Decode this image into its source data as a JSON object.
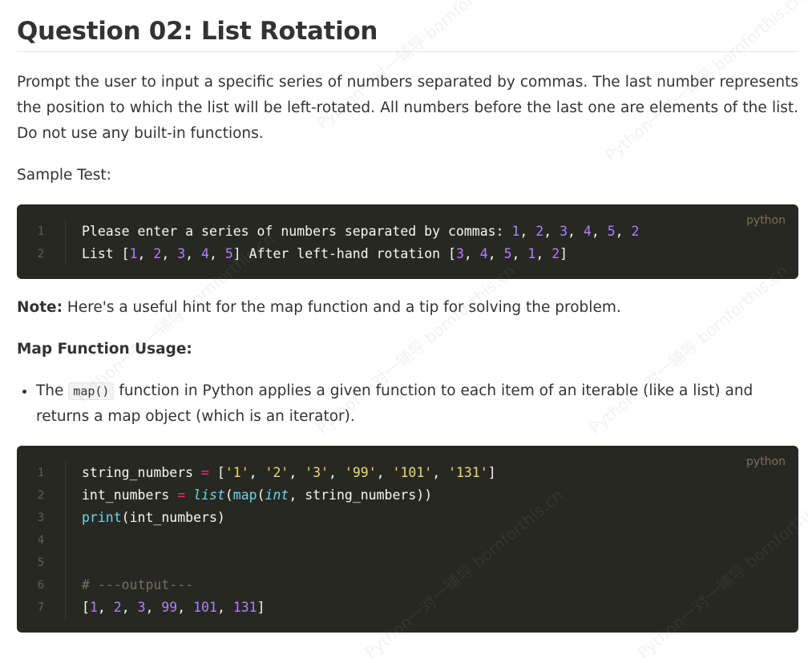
{
  "title": "Question 02: List Rotation",
  "prompt": "Prompt the user to input a specific series of numbers separated by commas. The last number represents the position to which the list will be left-rotated. All numbers before the last one are elements of the list. Do not use any built-in functions.",
  "sample_label": "Sample Test:",
  "sample_code": {
    "lang": "python",
    "lines": [
      {
        "n": "1",
        "text": "Please enter a series of numbers separated by commas: 1, 2, 3, 4, 5, 2"
      },
      {
        "n": "2",
        "text": "List [1, 2, 3, 4, 5] After left-hand rotation [3, 4, 5, 1, 2]"
      }
    ]
  },
  "note": {
    "label": "Note:",
    "text": " Here's a useful hint for the map function and a tip for solving the problem."
  },
  "map_usage_heading": "Map Function Usage:",
  "bullet": {
    "before": "The ",
    "code": "map()",
    "after": " function in Python applies a given function to each item of an iterable (like a list) and returns a map object (which is an iterator)."
  },
  "map_code": {
    "lang": "python",
    "lines": [
      {
        "n": "1",
        "text": "string_numbers = ['1', '2', '3', '99', '101', '131']"
      },
      {
        "n": "2",
        "text": "int_numbers = list(map(int, string_numbers))"
      },
      {
        "n": "3",
        "text": "print(int_numbers)"
      },
      {
        "n": "4",
        "text": ""
      },
      {
        "n": "5",
        "text": ""
      },
      {
        "n": "6",
        "text": "# ---output---"
      },
      {
        "n": "7",
        "text": "[1, 2, 3, 99, 101, 131]"
      }
    ]
  },
  "watermark_text": "Python一对一辅导 bornforthis.cn"
}
